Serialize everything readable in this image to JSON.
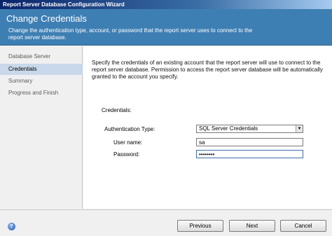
{
  "window": {
    "title": "Report Server Database Configuration Wizard"
  },
  "header": {
    "title": "Change Credentials",
    "description": "Change the authentication type, account, or password that the report server uses to connect to the report server database."
  },
  "sidebar": {
    "items": [
      {
        "label": "Database Server"
      },
      {
        "label": "Credentials",
        "active": true
      },
      {
        "label": "Summary"
      },
      {
        "label": "Progress and Finish"
      }
    ]
  },
  "main": {
    "intro": "Specify the credentials of an existing account that the report server will use to connect to the report server database.  Permission to access the report server database will be automatically granted to the account you specify.",
    "credentials_label": "Credentials:",
    "auth_type": {
      "label": "Authentication Type:",
      "value": "SQL Server Credentials"
    },
    "username": {
      "label": "User name:",
      "value": "sa"
    },
    "password": {
      "label": "Password:",
      "value": "sa123456"
    }
  },
  "buttons": {
    "previous": "Previous",
    "next": "Next",
    "cancel": "Cancel"
  },
  "help": {
    "glyph": "?"
  }
}
